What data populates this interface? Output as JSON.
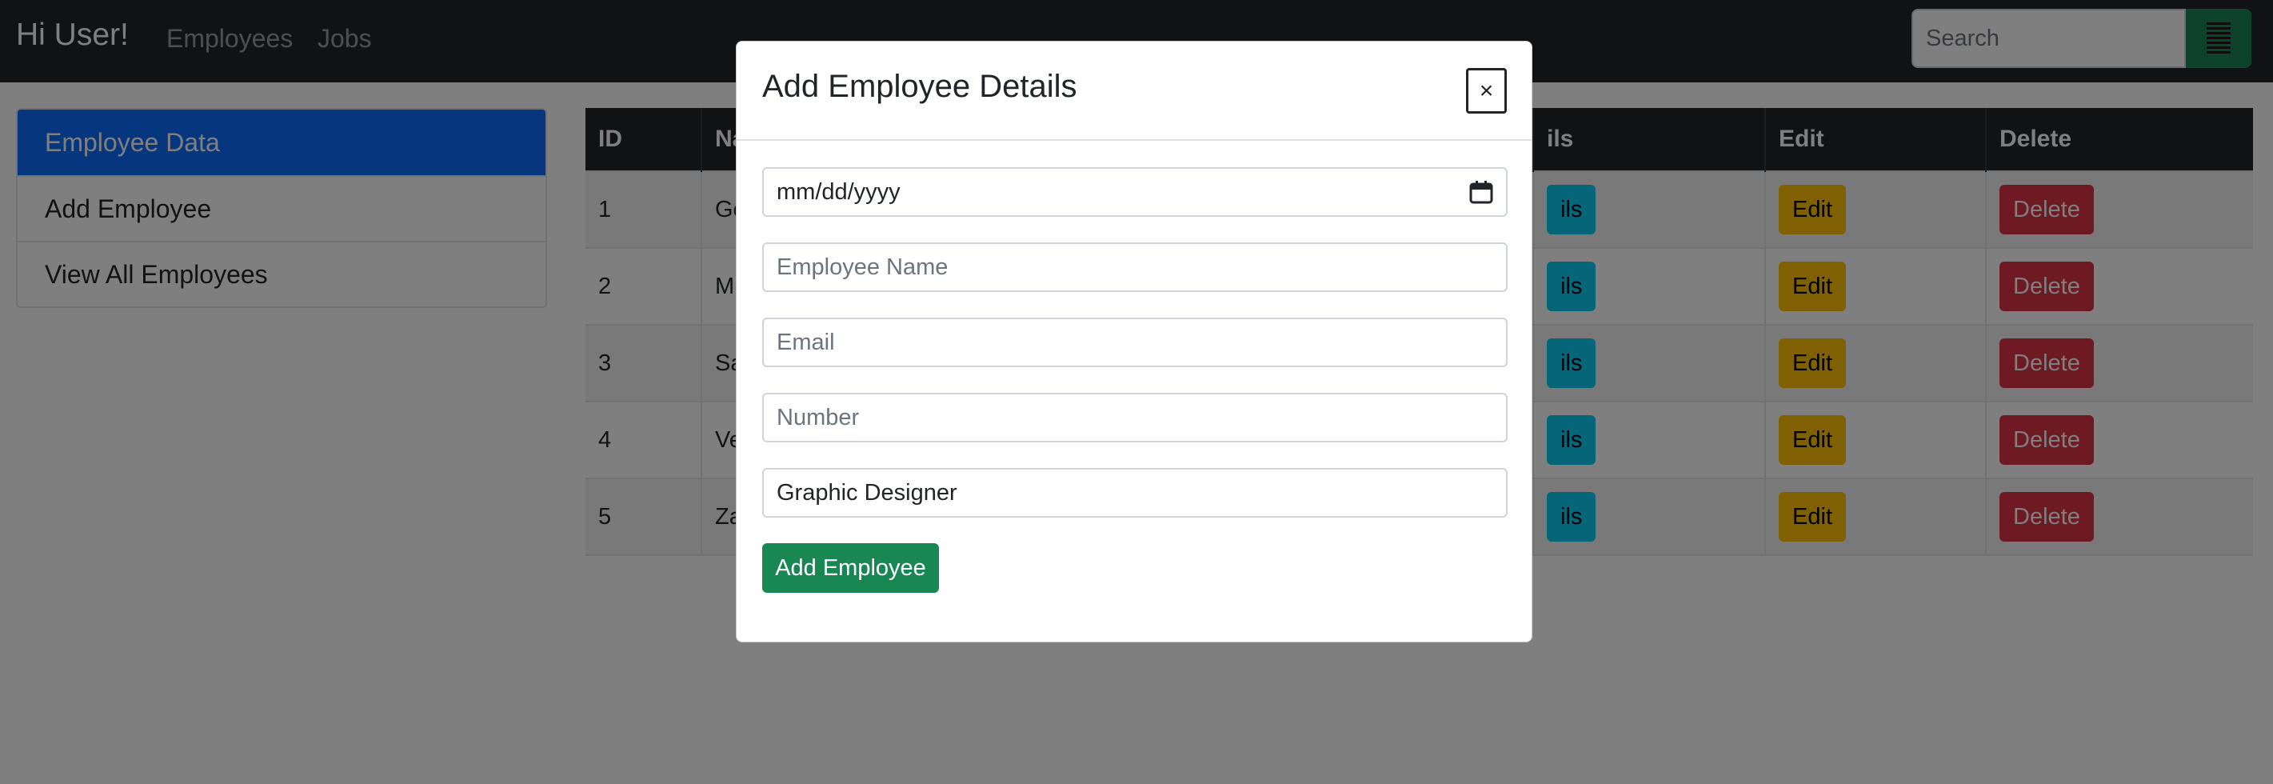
{
  "navbar": {
    "brand": "Hi User!",
    "links": [
      "Employees",
      "Jobs"
    ],
    "search_placeholder": "Search",
    "search_icon": "list-icon",
    "search_button_color": "#198754"
  },
  "sidebar": {
    "items": [
      {
        "label": "Employee Data",
        "active": true
      },
      {
        "label": "Add Employee",
        "active": false
      },
      {
        "label": "View All Employees",
        "active": false
      }
    ]
  },
  "table": {
    "headers": [
      "ID",
      "Name",
      "Details",
      "Edit",
      "Delete"
    ],
    "visible_headers": [
      "ID",
      "Na",
      "ils",
      "Edit",
      "Delete"
    ],
    "rows": [
      {
        "id": "1",
        "name": "Go",
        "details": "ils",
        "edit": "Edit",
        "delete": "Delete"
      },
      {
        "id": "2",
        "name": "M",
        "details": "ils",
        "edit": "Edit",
        "delete": "Delete"
      },
      {
        "id": "3",
        "name": "Sa",
        "details": "ils",
        "edit": "Edit",
        "delete": "Delete"
      },
      {
        "id": "4",
        "name": "Ve",
        "details": "ils",
        "edit": "Edit",
        "delete": "Delete"
      },
      {
        "id": "5",
        "name": "Za",
        "details": "ils",
        "edit": "Edit",
        "delete": "Delete"
      }
    ]
  },
  "modal": {
    "title": "Add Employee Details",
    "close_label": "×",
    "date_placeholder": "mm/dd/yyyy",
    "name_placeholder": "Employee Name",
    "email_placeholder": "Email",
    "number_placeholder": "Number",
    "job_value": "Graphic Designer",
    "submit_label": "Add Employee"
  },
  "colors": {
    "primary": "#0d6efd",
    "success": "#198754",
    "info": "#0dcaf0",
    "warning": "#ffc107",
    "danger": "#dc3545",
    "dark": "#212529"
  }
}
